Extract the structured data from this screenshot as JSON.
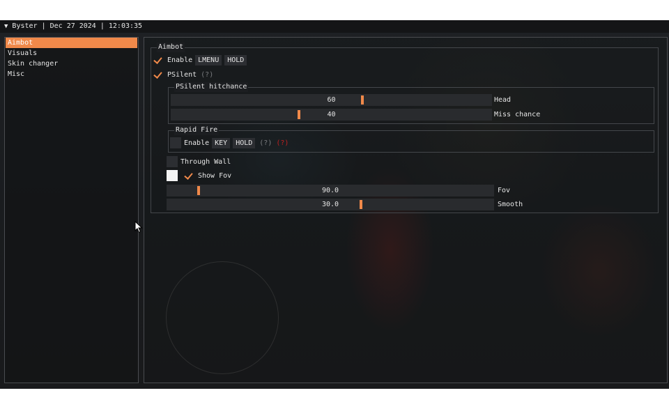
{
  "titlebar": {
    "collapse_glyph": "▼",
    "text": "Byster | Dec 27 2024 | 12:03:35"
  },
  "sidebar": {
    "items": [
      {
        "label": "Aimbot",
        "active": true
      },
      {
        "label": "Visuals",
        "active": false
      },
      {
        "label": "Skin changer",
        "active": false
      },
      {
        "label": "Misc",
        "active": false
      }
    ]
  },
  "aimbot": {
    "group_title": "Aimbot",
    "enable": {
      "label": "Enable",
      "checked": true,
      "key": "LMENU",
      "mode": "HOLD"
    },
    "psilent": {
      "label": "PSilent",
      "checked": true,
      "hint": "(?)"
    },
    "psilent_hitchance": {
      "group_title": "PSilent hitchance",
      "head": {
        "label": "Head",
        "value": "60",
        "min": 0,
        "max": 100,
        "numeric": 60
      },
      "miss": {
        "label": "Miss chance",
        "value": "40",
        "min": 0,
        "max": 100,
        "numeric": 40
      }
    },
    "rapid_fire": {
      "group_title": "Rapid Fire",
      "enable": {
        "label": "Enable",
        "checked": false,
        "key": "KEY",
        "mode": "HOLD",
        "hint": "(?)",
        "hint_warning": "(?)"
      }
    },
    "through_wall": {
      "label": "Through Wall",
      "checked": false
    },
    "show_fov": {
      "label": "Show Fov",
      "checked": true,
      "color": "#f4f4f4"
    },
    "fov": {
      "label": "Fov",
      "value": "90.0",
      "min": 0,
      "max": 1800,
      "numeric": 90.0
    },
    "smooth": {
      "label": "Smooth",
      "value": "30.0",
      "min": 0,
      "max": 120,
      "numeric": 30.0
    }
  },
  "colors": {
    "accent": "#f0894a",
    "warning": "#c02020",
    "hint": "#7b7d80"
  }
}
